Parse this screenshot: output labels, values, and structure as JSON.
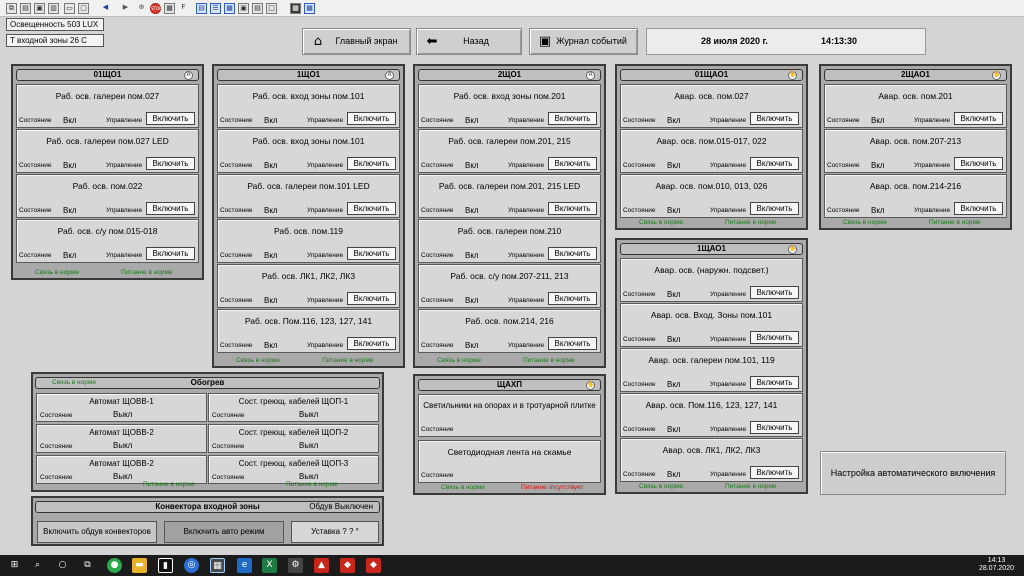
{
  "toolbar": {
    "icons": [
      "copy-icon",
      "paste-icon",
      "save-icon",
      "print-icon",
      "arrow-left-icon",
      "arrow-right-icon",
      "zoom-icon",
      "stop-icon",
      "screen-icon",
      "window-icon",
      "layout-icon",
      "gear-icon",
      "list-icon",
      "monitor-icon",
      "app-icon"
    ],
    "stop_label": "STOP",
    "f_label": "F"
  },
  "status": {
    "illumination": "Освещенность  503 LUX",
    "temperature": "T входной зоны  26 C"
  },
  "nav": {
    "home": "Главный экран",
    "back": "Назад",
    "log": "Журнал событий"
  },
  "datetime": {
    "date": "28 июля 2020 г.",
    "time": "14:13:30"
  },
  "labels": {
    "state": "Состояние",
    "control": "Управление",
    "on": "Вкл",
    "off": "Выкл",
    "enable": "Включить",
    "link_ok": "Связь в норме",
    "power_ok": "Питание в норме",
    "power_missing": "Питание отсутствует"
  },
  "panels": [
    {
      "title": "01ЩО1",
      "badge": "A",
      "rows": [
        "Раб. осв. галереи пом.027",
        "Раб. осв. галереи пом.027 LED",
        "Раб. осв. пом.022",
        "Раб. осв. с/у пом.015-018"
      ]
    },
    {
      "title": "1ЩО1",
      "badge": "A",
      "rows": [
        "Раб. осв. вход зоны пом.101",
        "Раб. осв. вход зоны пом.101",
        "Раб. осв. галереи пом.101 LED",
        "Раб. осв. пом.119",
        "Раб. осв. ЛК1, ЛК2, ЛК3",
        "Раб. осв. Пом.116, 123, 127, 141"
      ]
    },
    {
      "title": "2ЩО1",
      "badge": "A",
      "rows": [
        "Раб. осв. вход зоны пом.201",
        "Раб. осв. галереи пом.201, 215",
        "Раб. осв. галереи пом.201, 215 LED",
        "Раб. осв. галереи пом.210",
        "Раб. осв. с/у пом.207-211, 213",
        "Раб. осв. пом.214, 216"
      ]
    },
    {
      "title": "01ЩАО1",
      "badge": "✋",
      "rows": [
        "Авар. осв. пом.027",
        "Авар. осв. пом.015-017, 022",
        "Авар. осв. пом.010, 013, 026"
      ]
    },
    {
      "title": "2ЩАО1",
      "badge": "✋",
      "rows": [
        "Авар. осв. пом.201",
        "Авар. осв. пом.207-213",
        "Авар. осв. пом.214-216"
      ]
    },
    {
      "title": "1ЩАО1",
      "badge": "✋",
      "rows": [
        "Авар. осв. (наружн. подсвет.)",
        "Авар. осв. Вход. Зоны пом.101",
        "Авар. осв. галереи пом.101, 119",
        "Авар. осв. Пом.116, 123, 127, 141",
        "Авар. осв. ЛК1, ЛК2, ЛК3"
      ]
    }
  ],
  "shchakhp": {
    "title": "ЩАХП",
    "badge": "✋",
    "rows": [
      "Светильники на опорах и в тротуарной плитке",
      "Светодиодная лента на скамье"
    ]
  },
  "heating": {
    "title": "Обогрев",
    "link": "Связь в норме",
    "left": [
      "Автомат  ЩОВВ-1",
      "Автомат  ЩОВВ-2",
      "Автомат  ЩОВВ-2"
    ],
    "right": [
      "Сост. греющ. кабелей ЩОП-1",
      "Сост. греющ. кабелей ЩОП-2",
      "Сост. греющ. кабелей ЩОП-3"
    ]
  },
  "convector": {
    "title": "Конвектора входной зоны",
    "status": "Обдув  Выключен",
    "btn_blow": "Включить обдув конвекторов",
    "btn_auto": "Включить авто режим",
    "setpoint": "Уставка   ? ? °"
  },
  "auto_setup": "Настройка автоматического включения",
  "taskbar": {
    "time": "14:13",
    "date": "28.07.2020"
  }
}
